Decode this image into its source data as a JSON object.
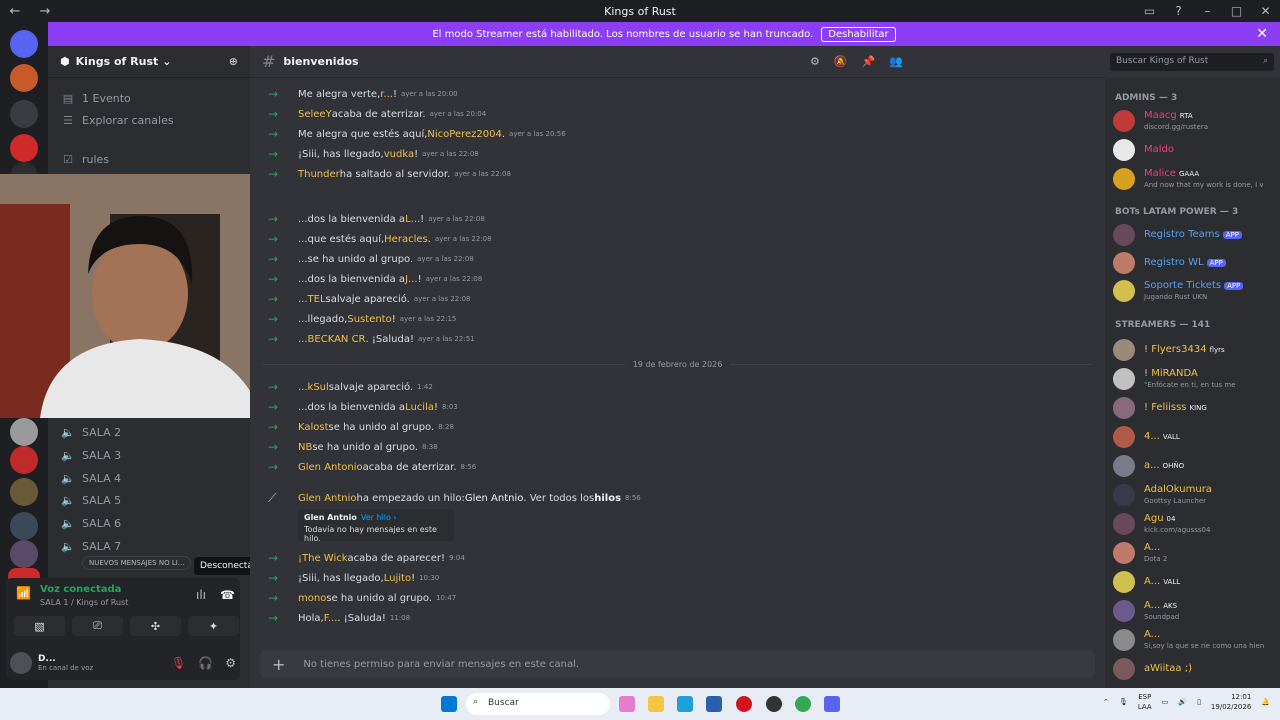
{
  "window": {
    "title": "Kings of Rust"
  },
  "banner": {
    "text": "El modo Streamer está habilitado. Los nombres de usuario se han truncado.",
    "button": "Deshabilitar"
  },
  "guild": {
    "name": "Kings of Rust"
  },
  "channels": {
    "events": "1 Evento",
    "explore": "Explorar canales",
    "rules": "rules",
    "voice": [
      "SALA 2",
      "SALA 3",
      "SALA 4",
      "SALA 5",
      "SALA 6",
      "SALA 7"
    ],
    "new_messages": "NUEVOS MENSAJES NO LI..."
  },
  "voice_panel": {
    "status": "Voz conectada",
    "location": "SALA 1 / Kings of Rust",
    "tooltip": "Desconectar",
    "user": "D...",
    "user_status": "En canal de voz"
  },
  "chat": {
    "channel": "bienvenidos",
    "search_placeholder": "Buscar Kings of Rust",
    "date_divider": "19 de febrero de 2026",
    "composer_placeholder": "No tienes permiso para enviar mensajes en este canal.",
    "messages": [
      {
        "pre": "Me alegra verte, ",
        "name": "r...",
        "post": "!",
        "time": "ayer a las 20:00"
      },
      {
        "pre": "",
        "name": "SeleeY",
        "post": " acaba de aterrizar.",
        "time": "ayer a las 20:04"
      },
      {
        "pre": "Me alegra que estés aquí, ",
        "name": "NicoPerez2004",
        "post": ".",
        "time": "ayer a las 20:56"
      },
      {
        "pre": "¡Siii, has llegado, ",
        "name": "vudka",
        "post": "!",
        "time": "ayer a las 22:08"
      },
      {
        "pre": "",
        "name": "Thunder",
        "post": " ha saltado al servidor.",
        "time": "ayer a las 22:08"
      },
      {
        "pre": "...dos la bienvenida a ",
        "name": "L...",
        "post": "!",
        "time": "ayer a las 22:08"
      },
      {
        "pre": "...que estés aquí, ",
        "name": "Heracles",
        "post": ".",
        "time": "ayer a las 22:08"
      },
      {
        "pre": "...se ha unido al grupo.",
        "name": "",
        "post": "",
        "time": "ayer a las 22:08"
      },
      {
        "pre": "...dos la bienvenida a ",
        "name": "J...",
        "post": "!",
        "time": "ayer a las 22:08"
      },
      {
        "pre": "",
        "name": "...TEL",
        "post": " salvaje apareció.",
        "time": "ayer a las 22:08"
      },
      {
        "pre": "...llegado, ",
        "name": "Sustento",
        "post": "!",
        "time": "ayer a las 22:15"
      },
      {
        "pre": "",
        "name": "...BECKAN CR",
        "post": ". ¡Saluda!",
        "time": "ayer a las 22:51"
      },
      {
        "pre": "",
        "name": "...kSul",
        "post": " salvaje apareció.",
        "time": "1:42"
      },
      {
        "pre": "...dos la bienvenida a ",
        "name": "Lucila",
        "post": "!",
        "time": "8:03"
      },
      {
        "pre": "",
        "name": "Kalost",
        "post": " se ha unido al grupo.",
        "time": "8:28"
      },
      {
        "pre": "",
        "name": "NB",
        "post": " se ha unido al grupo.",
        "time": "8:38"
      },
      {
        "pre": "",
        "name": "Glen Antonio",
        "post": " acaba de aterrizar.",
        "time": "8:56"
      },
      {
        "pre": "",
        "name": "¡The Wick",
        "post": " acaba de aparecer!",
        "time": "9:04"
      },
      {
        "pre": "¡Siii, has llegado, ",
        "name": "Lujito",
        "post": "!",
        "time": "10:30"
      },
      {
        "pre": "",
        "name": "mono",
        "post": " se ha unido al grupo.",
        "time": "10:47"
      },
      {
        "pre": "Hola, ",
        "name": "F...",
        "post": ". ¡Saluda!",
        "time": "11:08"
      }
    ],
    "thread_msg": {
      "name": "Glen Antnio",
      "mid": " ha empezado un hilo: ",
      "thread": "Glen Antnio",
      "tail": ". Ver todos los ",
      "link": "hilos",
      "time": "8:56"
    },
    "thread_card": {
      "title": "Glen Antnio",
      "link": "Ver hilo ›",
      "body": "Todavía no hay mensajes en este hilo."
    }
  },
  "members": {
    "groups": [
      "ADMINS — 3",
      "BOTs LATAM POWER — 3",
      "STREAMERS — 141"
    ],
    "admins": [
      {
        "name": "Maacg",
        "tag": "RTA",
        "status": "discord.gg/rustera",
        "color": "#f23f77"
      },
      {
        "name": "Maldo",
        "tag": "",
        "status": "",
        "color": "#f23f77"
      },
      {
        "name": "Malice",
        "tag": "GAAA",
        "status": "And now that my work is done, I v",
        "color": "#f23f77"
      }
    ],
    "bots": [
      {
        "name": "Registro Teams",
        "tag": "APP",
        "status": ""
      },
      {
        "name": "Registro WL",
        "tag": "APP",
        "status": ""
      },
      {
        "name": "Soporte Tickets",
        "tag": "APP",
        "status": "Jugando Rust UKN"
      }
    ],
    "streamers": [
      {
        "name": "! Flyers3434",
        "tag": "flyrs",
        "status": ""
      },
      {
        "name": "! MiRANDA",
        "tag": "",
        "status": "\"Enfócate en ti, en tus me"
      },
      {
        "name": "! Feliisss",
        "tag": "KING",
        "status": ""
      },
      {
        "name": "4...",
        "tag": "VALL",
        "status": ""
      },
      {
        "name": "a...",
        "tag": "OHÑO",
        "status": ""
      },
      {
        "name": "AdalOkumura",
        "tag": "",
        "status": "Goottsy Launcher"
      },
      {
        "name": "Agu",
        "tag": "04",
        "status": "kick.com/agusss04"
      },
      {
        "name": "A...",
        "tag": "",
        "status": "Dota 2"
      },
      {
        "name": "A...",
        "tag": "VALL",
        "status": ""
      },
      {
        "name": "A...",
        "tag": "AKS",
        "status": "Soundpad"
      },
      {
        "name": "A...",
        "tag": "",
        "status": "Si,soy la que se ríe como una hien"
      },
      {
        "name": "aWiitaa ;)",
        "tag": "",
        "status": ""
      }
    ]
  },
  "taskbar": {
    "search": "Buscar",
    "lang": "ESP",
    "lang2": "LAA",
    "time": "12:01",
    "date": "19/02/2026"
  }
}
